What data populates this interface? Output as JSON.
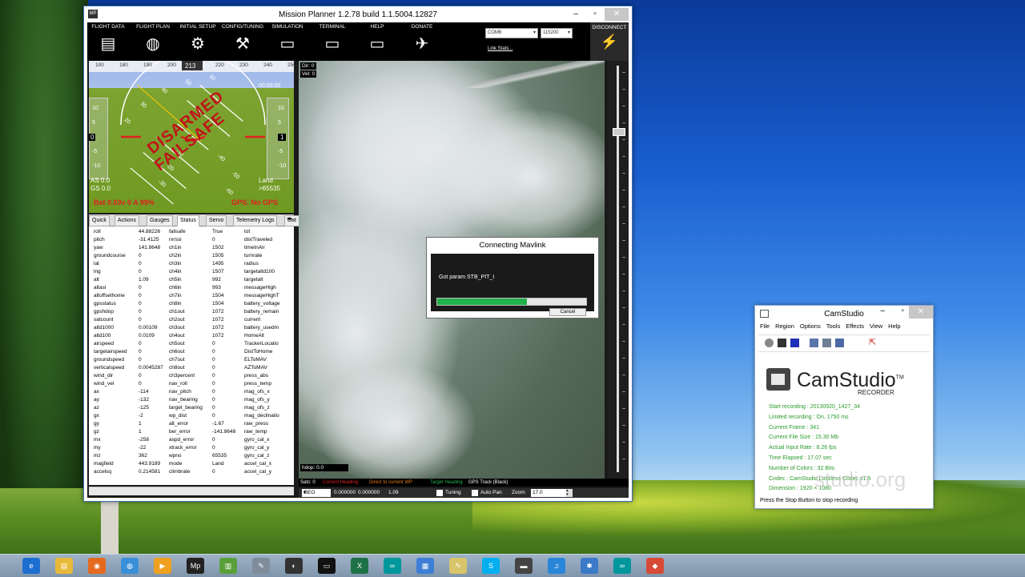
{
  "desktop": {
    "taskbar_icons": [
      "ie-icon",
      "folder-icon",
      "firefox-icon",
      "app-icon",
      "media-icon",
      "mission-planner-icon",
      "chart-icon",
      "tools-icon",
      "headset-icon",
      "terminal-icon",
      "excel-icon",
      "arduino-icon",
      "file-icon",
      "notepad-icon",
      "skype-icon",
      "video-icon",
      "itunes-icon",
      "bluetooth-icon",
      "arduino2-icon",
      "git-icon"
    ]
  },
  "mission_planner": {
    "title": "Mission Planner 1.2.78 build 1.1.5004.12827",
    "logo": "MP",
    "toolbar": [
      {
        "label": "FLIGHT DATA",
        "icon": "flight-data-icon",
        "glyph": "▤"
      },
      {
        "label": "FLIGHT PLAN",
        "icon": "globe-icon",
        "glyph": "◍"
      },
      {
        "label": "INITIAL SETUP",
        "icon": "initial-setup-icon",
        "glyph": "⚙"
      },
      {
        "label": "CONFIG/TUNING",
        "icon": "wrench-icon",
        "glyph": "⚒"
      },
      {
        "label": "SIMULATION",
        "icon": "monitor-icon",
        "glyph": "▭"
      },
      {
        "label": "TERMINAL",
        "icon": "terminal-icon",
        "glyph": "▭"
      },
      {
        "label": "HELP",
        "icon": "help-icon",
        "glyph": "▭"
      },
      {
        "label": "DONATE",
        "icon": "donate-icon",
        "glyph": "✈"
      }
    ],
    "com_port": "COM6",
    "baud_rate": "115200",
    "link_stats": "Link Stats...",
    "disconnect_label": "DISCONNECT",
    "hud": {
      "heading_scale": [
        "100",
        "180",
        "190",
        "200",
        "210",
        "220",
        "230",
        "240",
        "250"
      ],
      "heading_value": "213",
      "clock": "00:00:00",
      "pitch_left": [
        "10",
        "5",
        "0",
        "-5",
        "-10"
      ],
      "pitch_right": [
        "10",
        "5",
        "1",
        "-5",
        "-10"
      ],
      "left_value": "0",
      "right_value": "1",
      "roll_labels": [
        "60",
        "50",
        "40",
        "30",
        "20",
        "-10",
        "-20",
        "-30",
        "-40",
        "-50",
        "-60"
      ],
      "status1": "DISARMED",
      "status2": "FAILSAFE",
      "as": "AS 0.0",
      "gs": "GS 0.0",
      "mode": "Land",
      "distance": ">65535",
      "battery": "Bat 0.03v 0 A 99%",
      "gps": "GPS: No GPS"
    },
    "tabs": [
      "Quick",
      "Actions",
      "Gauges",
      "Status",
      "Servo",
      "Telemetry Logs",
      "Dat"
    ],
    "active_tab": "Status",
    "status_rows": [
      [
        "roll",
        "44.88226",
        "failsafe",
        "True",
        "tot",
        ""
      ],
      [
        "pitch",
        "-31.4125",
        "rxrssi",
        "0",
        "distTraveled",
        ""
      ],
      [
        "yaw",
        "141.8648",
        "ch1in",
        "1502",
        "timeInAir",
        ""
      ],
      [
        "groundcourse",
        "0",
        "ch2in",
        "1505",
        "turnrate",
        ""
      ],
      [
        "lat",
        "0",
        "ch3in",
        "1495",
        "radius",
        ""
      ],
      [
        "lng",
        "0",
        "ch4in",
        "1507",
        "targetaltd100",
        ""
      ],
      [
        "alt",
        "1.09",
        "ch5in",
        "992",
        "targetalt",
        ""
      ],
      [
        "altasl",
        "0",
        "ch6in",
        "993",
        "messageHigh",
        ""
      ],
      [
        "altoffsethome",
        "0",
        "ch7in",
        "1504",
        "messageHighT",
        ""
      ],
      [
        "gpsstatus",
        "0",
        "ch8in",
        "1504",
        "battery_voltage",
        ""
      ],
      [
        "gpshdop",
        "0",
        "ch1out",
        "1072",
        "battery_remain",
        ""
      ],
      [
        "satcount",
        "0",
        "ch2out",
        "1072",
        "current",
        ""
      ],
      [
        "altd1000",
        "0.00109",
        "ch3out",
        "1072",
        "battery_usedm",
        ""
      ],
      [
        "altd100",
        "0.0109",
        "ch4out",
        "1072",
        "HomeAlt",
        ""
      ],
      [
        "airspeed",
        "0",
        "ch5out",
        "0",
        "TrackerLocatio",
        ""
      ],
      [
        "targetairspeed",
        "0",
        "ch6out",
        "0",
        "DistToHome",
        ""
      ],
      [
        "groundspeed",
        "0",
        "ch7out",
        "0",
        "ELToMAV",
        ""
      ],
      [
        "verticalspeed",
        "0.0045287",
        "ch8out",
        "0",
        "AZToMAV",
        ""
      ],
      [
        "wind_dir",
        "0",
        "ch3percent",
        "0",
        "press_abs",
        ""
      ],
      [
        "wind_vel",
        "0",
        "nav_roll",
        "0",
        "press_temp",
        ""
      ],
      [
        "ax",
        "-114",
        "nav_pitch",
        "0",
        "mag_ofs_x",
        ""
      ],
      [
        "ay",
        "-132",
        "nav_bearing",
        "0",
        "mag_ofs_y",
        ""
      ],
      [
        "az",
        "-125",
        "target_bearing",
        "0",
        "mag_ofs_z",
        ""
      ],
      [
        "gx",
        "-2",
        "wp_dist",
        "0",
        "mag_declinatio",
        ""
      ],
      [
        "gy",
        "1",
        "alt_error",
        "-1.67",
        "raw_press",
        ""
      ],
      [
        "gz",
        "1",
        "ber_error",
        "-141.8648",
        "raw_temp",
        ""
      ],
      [
        "mx",
        "-258",
        "aspd_error",
        "0",
        "gyro_cal_x",
        ""
      ],
      [
        "my",
        "-22",
        "xtrack_error",
        "0",
        "gyro_cal_y",
        ""
      ],
      [
        "mz",
        "362",
        "wpno",
        "65535",
        "gyro_cal_z",
        ""
      ],
      [
        "magfield",
        "443.9189",
        "mode",
        "Land",
        "accel_cal_x",
        ""
      ],
      [
        "accelsq",
        "0.214581",
        "climbrate",
        "0",
        "accel_cal_y",
        ""
      ]
    ],
    "map": {
      "dir": "Dir: 0",
      "vel": "Vel: 0",
      "hdop": "hdop: 0.0",
      "sats": "Sats: 0",
      "legend": [
        {
          "text": "Current Heading",
          "color": "#e02020"
        },
        {
          "text": "Direct to current WP",
          "color": "#e07a1a"
        },
        {
          "text": "Target Heading",
          "color": "#22b14c"
        },
        {
          "text": "GPS Track (Black)",
          "color": "#ffffff"
        }
      ],
      "coord_system": "GEO",
      "coord_x": "0.000000",
      "coord_y": "0.000000",
      "coord_alt": "1.09",
      "tuning_label": "Tuning",
      "autopan_label": "Auto Pan",
      "zoom_label": "Zoom",
      "zoom_value": "17.0"
    },
    "dialog": {
      "title": "Connecting Mavlink",
      "message": "Got param STB_PIT_I",
      "progress": 0.6,
      "cancel_label": "Cancel"
    }
  },
  "camstudio": {
    "title": "CamStudio",
    "menu": [
      "File",
      "Region",
      "Options",
      "Tools",
      "Effects",
      "View",
      "Help"
    ],
    "brand": "CamStudio",
    "brand_tm": "TM",
    "brand_sub": "RECORDER",
    "info": [
      "Start recording : 20130920_1427_34",
      "Limited recording : On, 1750 ms",
      "Current Frame : 341",
      "Current File Size : 15.30 Mb",
      "Actual Input Rate : 8.26 fps",
      "Time Elapsed : 17.07 sec",
      "Number of Colors : 32 Bits",
      "Codec : CamStudio Lossless Codec v1.5",
      "Dimension : 1920 × 1080"
    ],
    "footer": "Press the Stop Button to stop recording",
    "watermark": "studio.org"
  }
}
